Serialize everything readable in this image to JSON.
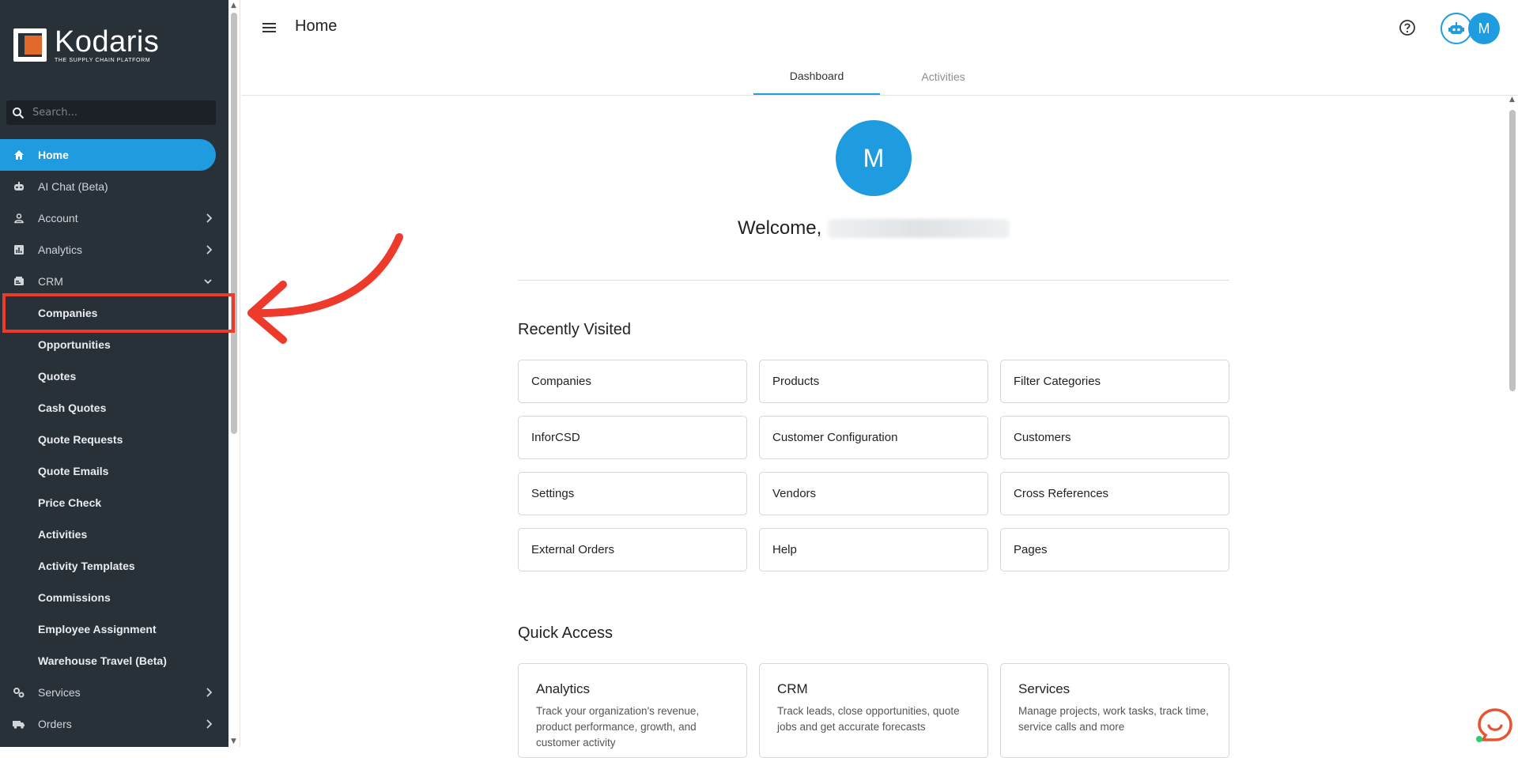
{
  "app": {
    "logo_name": "Kodaris",
    "logo_tagline": "THE SUPPLY CHAIN PLATFORM",
    "brand_color": "#1f9be0",
    "sidebar_color": "#283038",
    "annotation_color": "#ee3a2b"
  },
  "sidebar": {
    "search_placeholder": "Search...",
    "items": [
      {
        "label": "Home",
        "icon": "home-icon",
        "active": true
      },
      {
        "label": "AI Chat (Beta)",
        "icon": "robot-icon"
      },
      {
        "label": "Account",
        "icon": "person-icon",
        "chevron": "right"
      },
      {
        "label": "Analytics",
        "icon": "chart-icon",
        "chevron": "right"
      },
      {
        "label": "CRM",
        "icon": "crm-icon",
        "chevron": "down"
      }
    ],
    "crm_sub": [
      "Companies",
      "Opportunities",
      "Quotes",
      "Cash Quotes",
      "Quote Requests",
      "Quote Emails",
      "Price Check",
      "Activities",
      "Activity Templates",
      "Commissions",
      "Employee Assignment",
      "Warehouse Travel (Beta)"
    ],
    "bottom_items": [
      {
        "label": "Services",
        "icon": "gears-icon",
        "chevron": "right"
      },
      {
        "label": "Orders",
        "icon": "truck-icon",
        "chevron": "right"
      }
    ]
  },
  "header": {
    "title": "Home",
    "user_initial": "M",
    "tabs": [
      "Dashboard",
      "Activities"
    ],
    "active_tab": "Dashboard"
  },
  "main": {
    "avatar_initial": "M",
    "welcome": "Welcome,",
    "recently_visited_title": "Recently Visited",
    "recently_visited": [
      "Companies",
      "Products",
      "Filter Categories",
      "InforCSD",
      "Customer Configuration",
      "Customers",
      "Settings",
      "Vendors",
      "Cross References",
      "External Orders",
      "Help",
      "Pages"
    ],
    "quick_access_title": "Quick Access",
    "quick_access": [
      {
        "title": "Analytics",
        "desc": "Track your organization's revenue, product performance, growth, and customer activity"
      },
      {
        "title": "CRM",
        "desc": "Track leads, close opportunities, quote jobs and get accurate forecasts"
      },
      {
        "title": "Services",
        "desc": "Manage projects, work tasks, track time, service calls and more"
      }
    ]
  }
}
